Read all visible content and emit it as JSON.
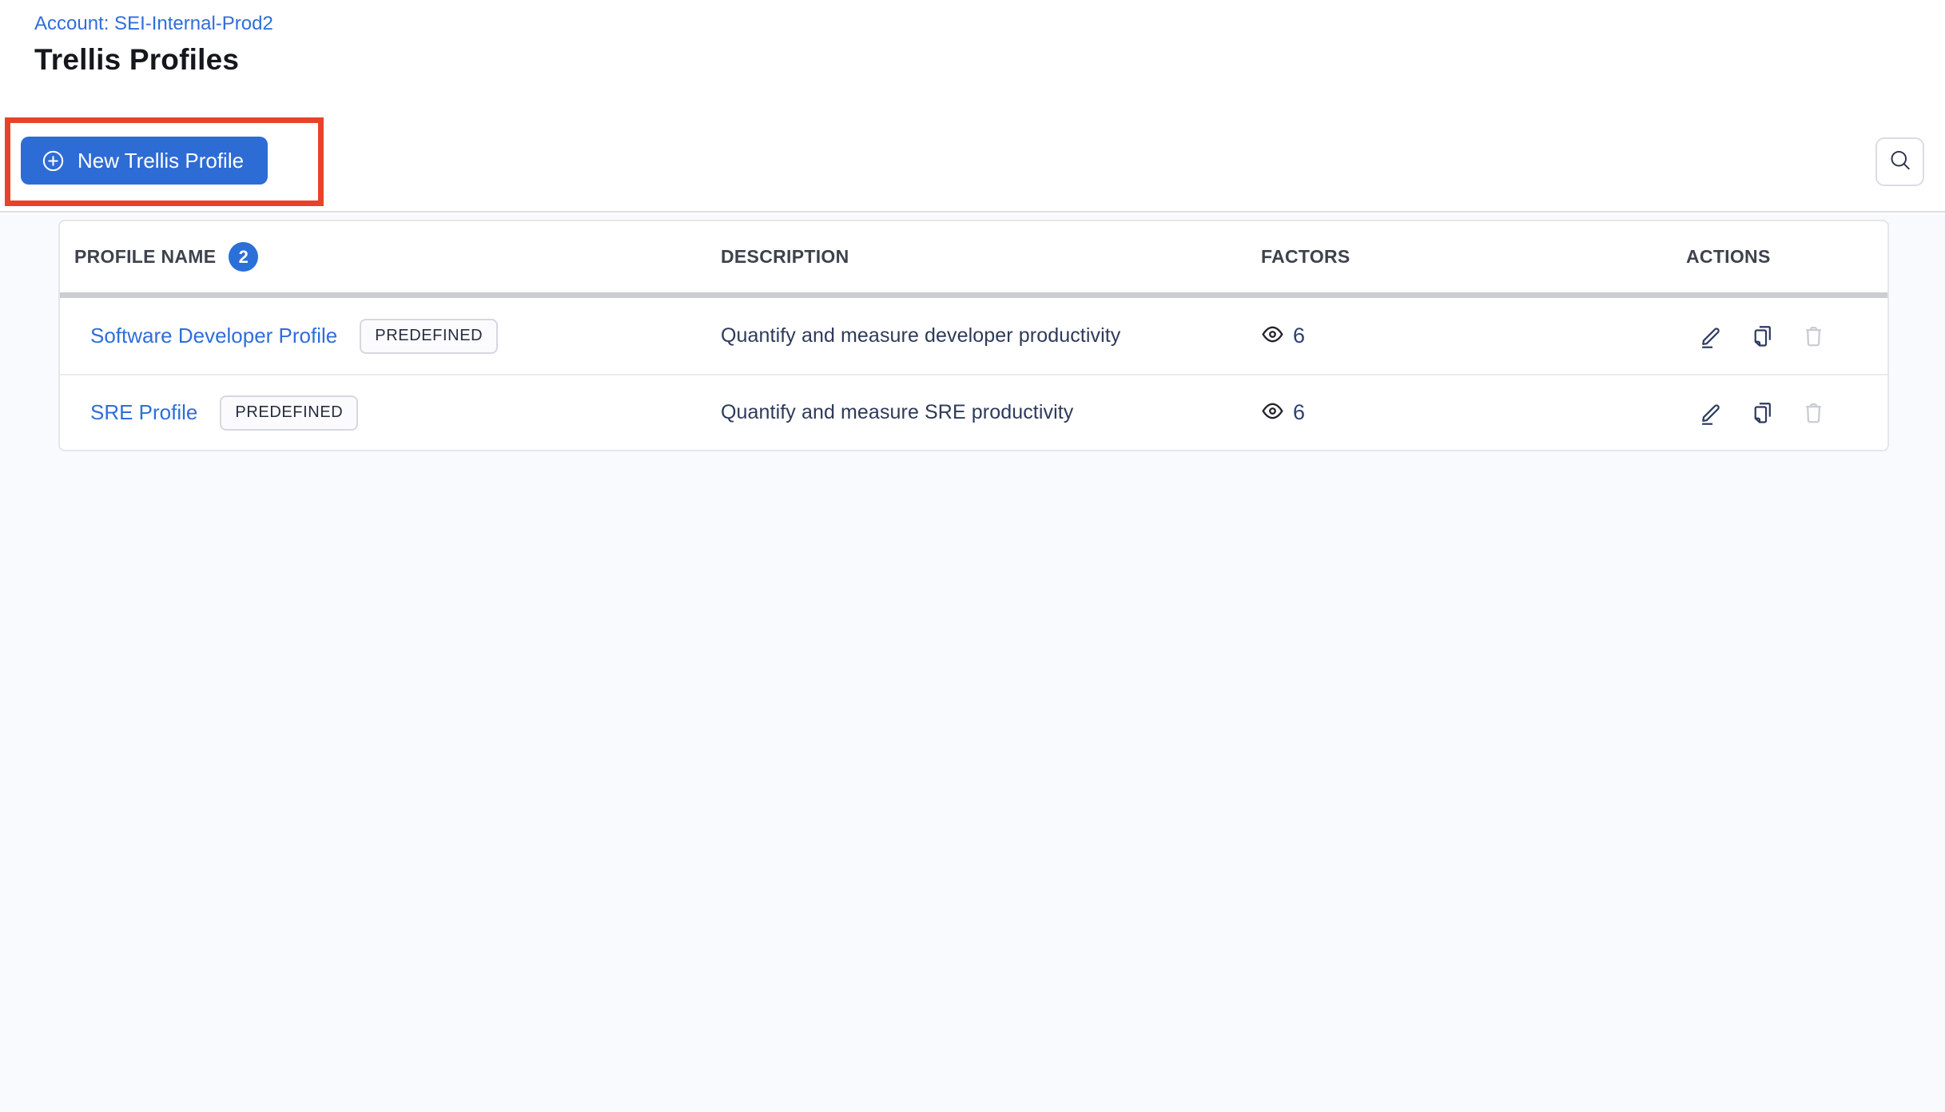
{
  "page": {
    "account_breadcrumb": "Account: SEI-Internal-Prod2",
    "title": "Trellis Profiles"
  },
  "toolbar": {
    "new_profile_button_label": "New Trellis Profile",
    "new_profile_button_icon": "plus-circle-icon",
    "search_button_icon": "search-icon",
    "annotation": {
      "type": "highlight-box",
      "color": "#e8432a"
    }
  },
  "table": {
    "headers": {
      "profile_name": "PROFILE NAME",
      "profile_count": "2",
      "description": "DESCRIPTION",
      "factors": "FACTORS",
      "actions": "ACTIONS"
    },
    "rows": [
      {
        "name": "Software Developer Profile",
        "tag": "PREDEFINED",
        "description": "Quantify and measure developer productivity",
        "factors_icon": "eye-icon",
        "factors_count": "6",
        "actions": {
          "edit_icon": "edit-pencil-icon",
          "copy_icon": "copy-icon",
          "delete_icon": "trash-icon",
          "delete_enabled": false
        }
      },
      {
        "name": "SRE Profile",
        "tag": "PREDEFINED",
        "description": "Quantify and measure SRE productivity",
        "factors_icon": "eye-icon",
        "factors_count": "6",
        "actions": {
          "edit_icon": "edit-pencil-icon",
          "copy_icon": "copy-icon",
          "delete_icon": "trash-icon",
          "delete_enabled": false
        }
      }
    ]
  },
  "colors": {
    "accent_blue": "#2e6cd5",
    "link_blue": "#2f6ed9",
    "count_badge_blue": "#2b70d8",
    "annotation_red": "#e8432a",
    "header_text": "#3e424c",
    "description_text": "#2e3a59",
    "action_icon_navy": "#2c3a5e",
    "disabled_icon_gray": "#c9ccd5",
    "content_background": "#f9fafd"
  }
}
